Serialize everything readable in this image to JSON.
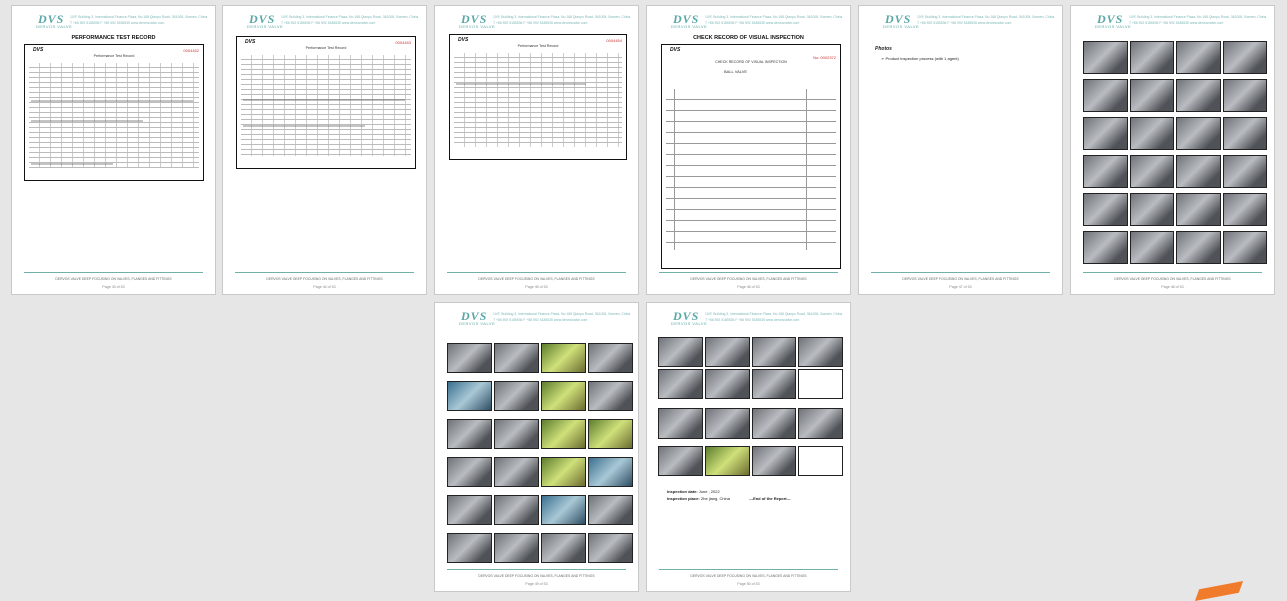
{
  "header": {
    "logo": "DVS",
    "logo_sub": "DERVOS VALVE",
    "address": "10/F, Building 3, International Finance Plaza, No.168 Qianpu Road, 361008, Xiamen, China",
    "contacts": "T +86 592 5185536   F +86 592 5185535   www.dervosvalve.com"
  },
  "footer_text": "DERVOS VALVE DEEP FOCUSING ON VALVES, FLANGES AND FITTINGS",
  "pages": [
    {
      "page_no": "Page 43 of 53",
      "title": "PERFORMANCE TEST RECORD",
      "scan_title": "Performance Test Record",
      "scan_no": "0004452"
    },
    {
      "page_no": "Page 44 of 53",
      "scan_title": "Performance Test Record",
      "scan_no": "0004453"
    },
    {
      "page_no": "Page 45 of 53",
      "scan_title": "Performance Test Record",
      "scan_no": "0004454"
    },
    {
      "page_no": "Page 46 of 53",
      "title": "CHECK RECORD OF VISUAL INSPECTION",
      "scan_title": "CHECK RECORD OF VISUAL INSPECTION",
      "scan_no": "No: 0002372",
      "valve_type": "BALL VALVE"
    },
    {
      "page_no": "Page 47 of 53",
      "heading": "Photos",
      "bullet": "Product inspection process (with 1 agent)"
    },
    {
      "page_no": "Page 48 of 53"
    },
    {
      "page_no": "Page 49 of 53"
    },
    {
      "page_no": "Page 50 of 53",
      "inspection_date_label": "Inspection date:",
      "inspection_date": "June , 2022",
      "inspection_place_label": "Inspection place:",
      "inspection_place": "Zhe jiang, China",
      "end_text": "---End of the Report---"
    }
  ],
  "icons": {
    "move": "move-handle-icon"
  },
  "colors": {
    "accent": "#5aa7a7",
    "footer_line": "#6fb0a8",
    "serial": "#cc3333"
  }
}
